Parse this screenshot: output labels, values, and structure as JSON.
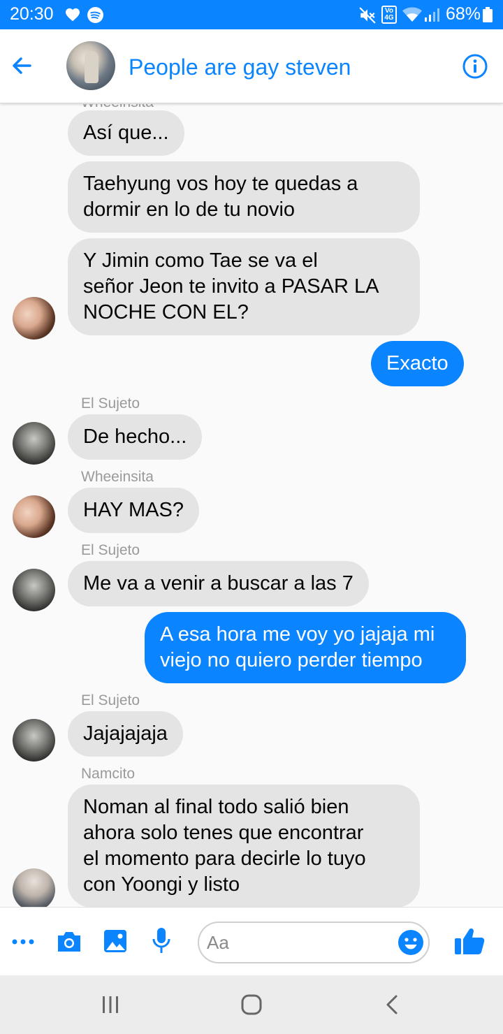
{
  "status_bar": {
    "time": "20:30",
    "battery": "68%",
    "network_badge": "Vo 4G",
    "icons": [
      "heart-icon",
      "spotify-icon",
      "mute-icon",
      "volte-icon",
      "wifi-icon",
      "signal-icon",
      "battery-icon"
    ]
  },
  "header": {
    "title": "People are gay steven",
    "back_icon": "arrow-left-icon",
    "info_icon": "info-icon"
  },
  "messages": [
    {
      "sender": "Wheeinsita",
      "text_lines": [
        "Así que..."
      ],
      "direction": "in"
    },
    {
      "sender": "",
      "text_lines": [
        "Taehyung vos hoy te quedas a",
        "dormir en lo de tu novio"
      ],
      "direction": "in"
    },
    {
      "sender": "",
      "text_lines": [
        "Y Jimin como Tae se va el",
        "señor Jeon te invito a PASAR LA",
        "NOCHE CON EL?"
      ],
      "direction": "in"
    },
    {
      "sender": "",
      "text_lines": [
        "Exacto"
      ],
      "direction": "out"
    },
    {
      "sender": "El Sujeto",
      "text_lines": [
        "De hecho..."
      ],
      "direction": "in"
    },
    {
      "sender": "Wheeinsita",
      "text_lines": [
        "HAY MAS?"
      ],
      "direction": "in"
    },
    {
      "sender": "El Sujeto",
      "text_lines": [
        "Me va a venir a buscar a las 7"
      ],
      "direction": "in"
    },
    {
      "sender": "",
      "text_lines": [
        "A esa hora me voy yo jajaja mi",
        "viejo no quiero perder tiempo"
      ],
      "direction": "out"
    },
    {
      "sender": "El Sujeto",
      "text_lines": [
        "Jajajajaja"
      ],
      "direction": "in"
    },
    {
      "sender": "Namcito",
      "text_lines": [
        "Noman al final todo salió bien",
        "ahora solo tenes que encontrar",
        "el momento para decirle lo tuyo",
        "con Yoongi y listo"
      ],
      "direction": "in"
    }
  ],
  "composer": {
    "placeholder": "Aa",
    "icons": [
      "more-icon",
      "camera-icon",
      "gallery-icon",
      "microphone-icon",
      "emoji-icon",
      "thumbs-up-icon"
    ]
  },
  "nav_bar": {
    "icons": [
      "recents-icon",
      "home-icon",
      "back-icon"
    ]
  },
  "colors": {
    "accent": "#0a84ff",
    "incoming_bubble": "#e4e4e4",
    "sender_label": "#9a9a9a",
    "background": "#fafafa"
  }
}
